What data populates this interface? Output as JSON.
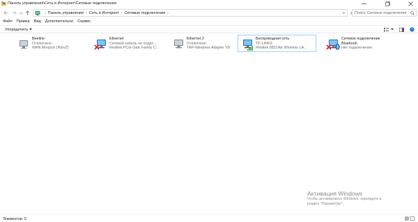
{
  "window": {
    "title": "Панель управления\\Сеть и Интернет\\Сетевые подключения",
    "minimize_icon": "minimize-icon",
    "maximize_icon": "maximize-icon",
    "close_icon": "close-icon"
  },
  "address": {
    "crumbs": [
      "Панель управления",
      "Сеть и Интернет",
      "Сетевые подключения"
    ]
  },
  "search": {
    "placeholder": "Поиск: Сетевые подключения"
  },
  "menu": [
    "Файл",
    "Правка",
    "Вид",
    "Дополнительно",
    "Сервис"
  ],
  "commandbar": {
    "organize": "Упорядочить"
  },
  "connections": [
    {
      "name": "Beeline",
      "status": "Отключено",
      "device": "WAN Miniport (IKEv2)",
      "icon": "dialup-connection-icon",
      "selected": false,
      "error": false
    },
    {
      "name": "Ethernet",
      "status": "Сетевой кабель не подкл...",
      "device": "Realtek PCIe GbE Family C...",
      "icon": "ethernet-adapter-icon",
      "selected": false,
      "error": true
    },
    {
      "name": "Ethernet 2",
      "status": "Отключено",
      "device": "TAP-Windows Adapter V9",
      "icon": "ethernet-adapter-icon",
      "selected": false,
      "error": false
    },
    {
      "name": "Беспроводная сеть",
      "status": "TP-LINK9",
      "device": "Realtek 8821AE Wireless LA...",
      "icon": "wireless-adapter-icon",
      "selected": true,
      "error": false
    },
    {
      "name": "Сетевое подключение Bluetooth",
      "name_line1": "Сетевое подключение",
      "name_line2": "Bluetooth",
      "status": "Нет подключения",
      "device": "",
      "icon": "bluetooth-adapter-icon",
      "selected": false,
      "error": true
    }
  ],
  "watermark": {
    "title": "Активация Windows",
    "line1": "Чтобы активировать Windows, перейдите в",
    "line2": "раздел \"Параметры\"."
  },
  "status": {
    "count": "Элементов: 5"
  },
  "colors": {
    "selection_border": "#99d1ff",
    "accent": "#0078d7",
    "error": "#e81123"
  }
}
